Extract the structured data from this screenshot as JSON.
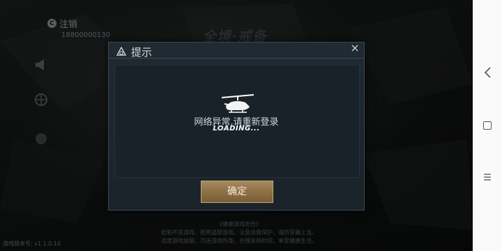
{
  "account": {
    "logout_label": "注销",
    "phone": "18800000130"
  },
  "background": {
    "logo_text": "全境·戒备",
    "notice_title": "《健康游戏忠告》",
    "notice_line1": "抵制不良游戏，拒绝盗版游戏。注意自我保护，谨防受骗上当。",
    "notice_line2": "适度游戏益脑，沉迷游戏伤身。合理安排时间，享受健康生活。",
    "version": "游戏版本号: v1.1.0.10"
  },
  "dialog": {
    "title": "提示",
    "close_glyph": "×",
    "message": "网络异常,请重新登录",
    "loading": "LOADING...",
    "confirm_label": "确定"
  },
  "colors": {
    "dialog_bg": "#1f2830",
    "button_gold": "#9a7c4f"
  }
}
